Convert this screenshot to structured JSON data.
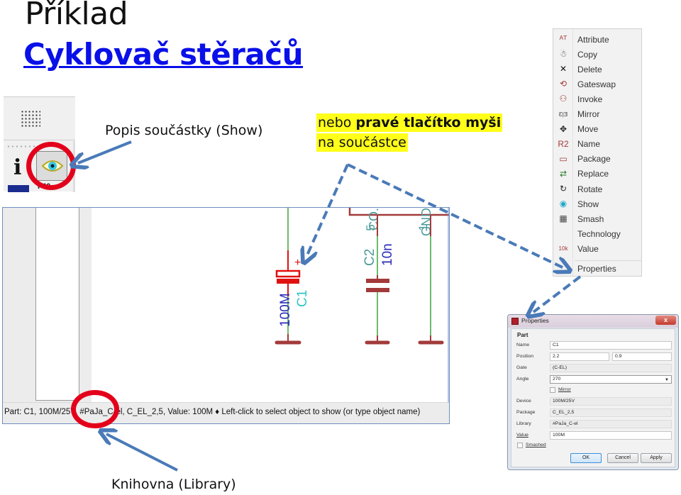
{
  "slide": {
    "title": "Příklad",
    "subtitle": "Cyklovač stěračů",
    "label_show": "Popis součástky (Show)",
    "note_line1_normal": "nebo ",
    "note_line1_bold": "pravé tlačítko myši",
    "note_line2": "na součástce",
    "label_library": "Knihovna (Library)"
  },
  "toolbar": {
    "info_icon_glyph": "i",
    "bottom_right_text": "I 40",
    "icons": [
      "grid-icon",
      "info-icon",
      "show-eye-icon"
    ]
  },
  "schematic": {
    "parts": {
      "c1_name": "C1",
      "c1_value": "100M",
      "c1_polarity": "+",
      "c2_name": "C2",
      "c2_value": "10n",
      "pin5": "5",
      "pin1": "1",
      "ic_label_left": "CO.",
      "ic_label_right": "GND"
    },
    "status": {
      "text": "Part: C1, 100M/25V, #PaJa_C-el, C_EL_2,5, Value: 100M",
      "bullet": "♦",
      "hint": "Left-click to select object to show (or type object name)"
    },
    "colors": {
      "net": "#3aa63a",
      "wire": "#a33a3a",
      "part_name": "#2ec4c4",
      "part_value": "#2b2bb8",
      "c1_body": "#e01010"
    }
  },
  "context_menu": {
    "items": [
      {
        "label": "Attribute",
        "icon": "attribute-icon",
        "glyph": "ᴬᵀ"
      },
      {
        "label": "Copy",
        "icon": "copy-icon",
        "glyph": "☃"
      },
      {
        "label": "Delete",
        "icon": "delete-icon",
        "glyph": "✕"
      },
      {
        "label": "Gateswap",
        "icon": "gateswap-icon",
        "glyph": "⟲"
      },
      {
        "label": "Invoke",
        "icon": "invoke-icon",
        "glyph": "⚇"
      },
      {
        "label": "Mirror",
        "icon": "mirror-icon",
        "glyph": "Ɛ|Ǝ"
      },
      {
        "label": "Move",
        "icon": "move-icon",
        "glyph": "✥"
      },
      {
        "label": "Name",
        "icon": "name-icon",
        "glyph": "R2"
      },
      {
        "label": "Package",
        "icon": "package-icon",
        "glyph": "▭"
      },
      {
        "label": "Replace",
        "icon": "replace-icon",
        "glyph": "⇄"
      },
      {
        "label": "Rotate",
        "icon": "rotate-icon",
        "glyph": "↻"
      },
      {
        "label": "Show",
        "icon": "show-eye-icon",
        "glyph": "◉"
      },
      {
        "label": "Smash",
        "icon": "smash-icon",
        "glyph": "▦"
      },
      {
        "label": "Technology",
        "icon": "",
        "glyph": ""
      },
      {
        "label": "Value",
        "icon": "value-icon",
        "glyph": "10k"
      }
    ],
    "footer_item": "Properties"
  },
  "properties_dialog": {
    "title": "Properties",
    "close_glyph": "x",
    "section": "Part",
    "fields": {
      "name_label": "Name",
      "name_value": "C1",
      "position_label": "Position",
      "position_x": "2.2",
      "position_y": "0.9",
      "gate_label": "Gate",
      "gate_value": "(C-EL)",
      "angle_label": "Angle",
      "angle_value": "270",
      "mirror_label": "Mirror",
      "mirror_checked": false,
      "device_label": "Device",
      "device_value": "100M/25V",
      "package_label": "Package",
      "package_value": "C_EL_2,5",
      "library_label": "Library",
      "library_value": "#PaJa_C-el",
      "value_label": "Value",
      "value_value": "100M",
      "smashed_label": "Smashed",
      "smashed_checked": false
    },
    "buttons": {
      "ok": "OK",
      "cancel": "Cancel",
      "apply": "Apply"
    }
  },
  "annotation_colors": {
    "arrow": "#4a7ab8",
    "circle": "#e3001b",
    "highlight": "#ffff1a",
    "subtitle": "#0a10e8"
  }
}
